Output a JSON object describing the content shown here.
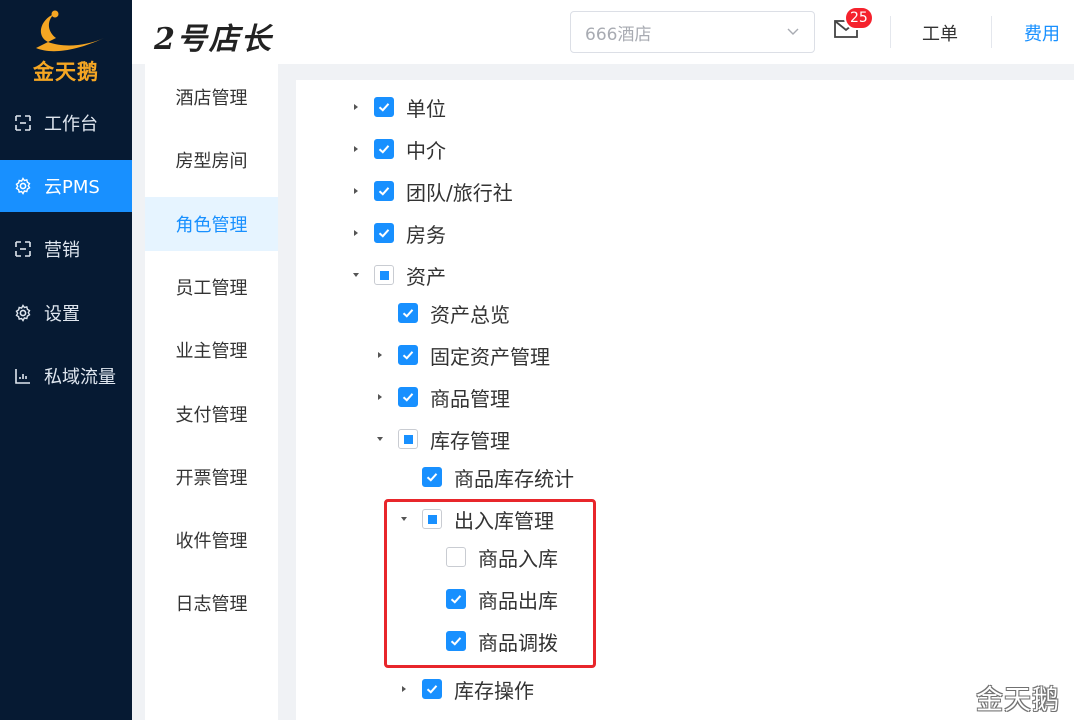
{
  "logo": {
    "text": "金天鹅"
  },
  "nav": [
    {
      "label": "工作台",
      "icon": "workbench-icon"
    },
    {
      "label": "云PMS",
      "icon": "gear-icon",
      "active": true
    },
    {
      "label": "营销",
      "icon": "marketing-icon"
    },
    {
      "label": "设置",
      "icon": "gear-icon"
    },
    {
      "label": "私域流量",
      "icon": "chart-icon"
    }
  ],
  "header": {
    "brand": "2号店长",
    "hotel_select": {
      "value": "666酒店",
      "icon": "chevron-down-icon"
    },
    "mail": {
      "icon": "mail-icon",
      "badge": "25"
    },
    "links": {
      "ticket": "工单",
      "fee": "费用"
    }
  },
  "submenu": [
    {
      "label": "酒店管理"
    },
    {
      "label": "房型房间"
    },
    {
      "label": "角色管理",
      "active": true
    },
    {
      "label": "员工管理"
    },
    {
      "label": "业主管理"
    },
    {
      "label": "支付管理"
    },
    {
      "label": "开票管理"
    },
    {
      "label": "收件管理"
    },
    {
      "label": "日志管理"
    }
  ],
  "tree": [
    {
      "label": "单位",
      "state": "checked",
      "caret": "right",
      "level": 0
    },
    {
      "label": "中介",
      "state": "checked",
      "caret": "right",
      "level": 0
    },
    {
      "label": "团队/旅行社",
      "state": "checked",
      "caret": "right",
      "level": 0
    },
    {
      "label": "房务",
      "state": "checked",
      "caret": "right",
      "level": 0
    },
    {
      "label": "资产",
      "state": "indeterminate",
      "caret": "down",
      "level": 0
    },
    {
      "label": "资产总览",
      "state": "checked",
      "caret": "none",
      "level": 1
    },
    {
      "label": "固定资产管理",
      "state": "checked",
      "caret": "right",
      "level": 1
    },
    {
      "label": "商品管理",
      "state": "checked",
      "caret": "right",
      "level": 1
    },
    {
      "label": "库存管理",
      "state": "indeterminate",
      "caret": "down",
      "level": 1
    },
    {
      "label": "商品库存统计",
      "state": "checked",
      "caret": "none",
      "level": 2
    },
    {
      "label": "出入库管理",
      "state": "indeterminate",
      "caret": "down",
      "level": 2
    },
    {
      "label": "商品入库",
      "state": "unchecked",
      "caret": "none",
      "level": 3
    },
    {
      "label": "商品出库",
      "state": "checked",
      "caret": "none",
      "level": 3
    },
    {
      "label": "商品调拨",
      "state": "checked",
      "caret": "none",
      "level": 3
    },
    {
      "label": "库存操作",
      "state": "checked",
      "caret": "right",
      "level": 2
    }
  ],
  "colors": {
    "accent": "#1890ff",
    "nav_bg": "#061a33",
    "highlight": "#e8262b",
    "badge": "#f5222d"
  },
  "watermark": "金天鹅"
}
